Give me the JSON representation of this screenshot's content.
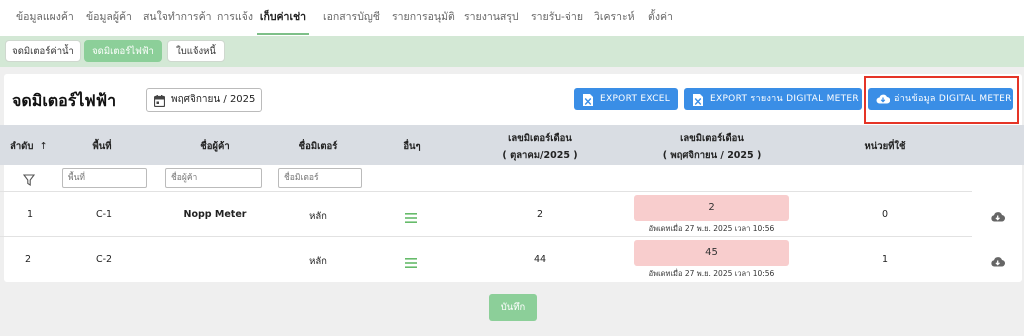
{
  "topnav": {
    "tabs": [
      "ข้อมูลแผงค้า",
      "ข้อมูลผู้ค้า",
      "สนใจทำการค้า",
      "การแจ้ง",
      "เก็บค่าเช่า",
      "เอกสารบัญชี",
      "รายการอนุมัติ",
      "รายงานสรุป",
      "รายรับ-จ่าย",
      "วิเคราะห์",
      "ตั้งค่า"
    ],
    "active_index": 4
  },
  "subtabs": [
    "จดมิเตอร์ค่าน้ำ",
    "จดมิเตอร์ไฟฟ้า",
    "ใบแจ้งหนี้"
  ],
  "page_title": "จดมิเตอร์ไฟฟ้า",
  "month_picker": {
    "value": "พฤศจิกายน / 2025",
    "icon": "calendar-icon"
  },
  "actions": {
    "export_excel": "EXPORT EXCEL",
    "export_report": "EXPORT รายงาน DIGITAL METER",
    "read_digital": "อ่านข้อมูล DIGITAL METER"
  },
  "table": {
    "headers": {
      "order": "ลำดับ",
      "area": "พื้นที่",
      "trader": "ชื่อผู้ค้า",
      "meter": "ชื่อมิเตอร์",
      "other": "อื่นๆ",
      "prev_line1": "เลขมิเตอร์เดือน",
      "prev_line2": "( ตุลาคม/2025 )",
      "curr_line1": "เลขมิเตอร์เดือน",
      "curr_line2": "( พฤศจิกายน / 2025 )",
      "units": "หน่วยที่ใช้"
    },
    "filters": {
      "area": "พื้นที่",
      "trader": "ชื่อผู้ค้า",
      "meter": "ชื่อมิเตอร์"
    },
    "rows": [
      {
        "order": "1",
        "area": "C-1",
        "trader": "Nopp Meter",
        "meter": "หลัก",
        "prev": "2",
        "curr": "2",
        "updated": "อัพเดทเมื่อ 27 พ.ย. 2025 เวลา 10:56",
        "units": "0"
      },
      {
        "order": "2",
        "area": "C-2",
        "trader": "",
        "meter": "หลัก",
        "prev": "44",
        "curr": "45",
        "updated": "อัพเดทเมื่อ 27 พ.ย. 2025 เวลา 10:56",
        "units": "1"
      }
    ]
  },
  "save_label": "บันทึก",
  "colors": {
    "accent_green": "#8ccf99",
    "subbar_green": "#d3e8d5",
    "button_blue": "#3a8ee6",
    "highlight_red": "#e53426",
    "reading_pink": "#f8cdcd"
  }
}
